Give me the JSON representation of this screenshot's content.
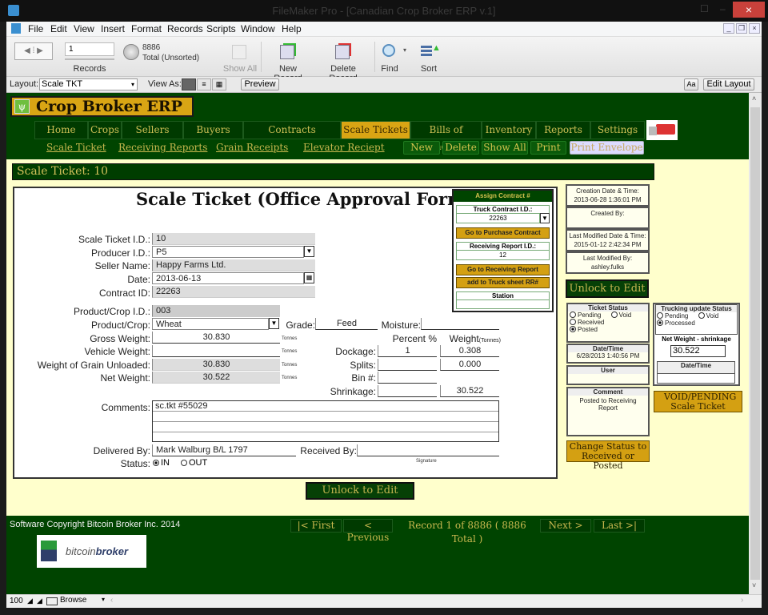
{
  "window": {
    "title": "FileMaker Pro - [Canadian Crop Broker ERP v.1]",
    "close": "×"
  },
  "menu": [
    "File",
    "Edit",
    "View",
    "Insert",
    "Format",
    "Records",
    "Scripts",
    "Window",
    "Help"
  ],
  "toolbar": {
    "record_number": "1",
    "records_label": "Records",
    "found_count": "8886",
    "found_status": "Total (Unsorted)",
    "show_all": "Show All",
    "new_record": "New Record",
    "delete_record": "Delete Record",
    "find": "Find",
    "sort": "Sort"
  },
  "layoutbar": {
    "layout_label": "Layout:",
    "layout_value": "Scale TKT",
    "view_as_label": "View As:",
    "preview": "Preview",
    "aa": "Aa",
    "edit_layout": "Edit Layout"
  },
  "app": {
    "brand": "Crop Broker ERP",
    "colors": {
      "dark_green": "#004400",
      "gold": "#d9a514",
      "cream": "#ffffcc"
    },
    "tabs": [
      {
        "label": "Home",
        "active": false
      },
      {
        "label": "Crops",
        "active": false
      },
      {
        "label": "Sellers",
        "active": false
      },
      {
        "label": "Buyers",
        "active": false
      },
      {
        "label": "Contracts",
        "active": false
      },
      {
        "label": "Scale Tickets",
        "active": true
      },
      {
        "label": "Bills of Lading",
        "active": false
      },
      {
        "label": "Inventory",
        "active": false
      },
      {
        "label": "Reports",
        "active": false
      },
      {
        "label": "Settings",
        "active": false
      }
    ],
    "sublinks": [
      "Scale Ticket",
      "Receiving Reports",
      "Grain Receipts",
      "Elevator Reciept"
    ],
    "actions": [
      "New",
      "Delete",
      "Show All",
      "Print",
      "Print Envelope"
    ],
    "section_title": "Scale Ticket: 10"
  },
  "form": {
    "title": "Scale Ticket (Office Approval Form)",
    "scale_ticket_id": {
      "label": "Scale Ticket I.D.:",
      "value": "10"
    },
    "producer_id": {
      "label": "Producer I.D.:",
      "value": "P5"
    },
    "seller_name": {
      "label": "Seller Name:",
      "value": "Happy Farms Ltd."
    },
    "date": {
      "label": "Date:",
      "value": "2013-06-13"
    },
    "contract_id": {
      "label": "Contract ID:",
      "value": "22263"
    },
    "product_crop_id": {
      "label": "Product/Crop I.D.:",
      "value": "003"
    },
    "product_crop": {
      "label": "Product/Crop:",
      "value": "Wheat"
    },
    "grade": {
      "label": "Grade:",
      "value": "Feed"
    },
    "moisture": {
      "label": "Moisture:",
      "value": ""
    },
    "gross_weight": {
      "label": "Gross Weight:",
      "value": "30.830"
    },
    "vehicle_weight": {
      "label": "Vehicle Weight:",
      "value": ""
    },
    "grain_unloaded": {
      "label": "Weight of Grain Unloaded:",
      "value": "30.830"
    },
    "net_weight": {
      "label": "Net Weight:",
      "value": "30.522"
    },
    "unit": "Tonnes",
    "percent_header": "Percent %",
    "weight_header": "Weight",
    "weight_unit": "(Tonnes)",
    "dockage": {
      "label": "Dockage:",
      "percent": "1",
      "weight": "0.308"
    },
    "splits": {
      "label": "Splits:",
      "percent": "",
      "weight": "0.000"
    },
    "bin": {
      "label": "Bin #:",
      "value": ""
    },
    "shrinkage": {
      "label": "Shrinkage:",
      "percent": "",
      "weight": "30.522"
    },
    "comments": {
      "label": "Comments:",
      "value": "sc.tkt #55029"
    },
    "delivered_by": {
      "label": "Delivered By:",
      "value": "Mark Walburg B/L 1797"
    },
    "received_by": {
      "label": "Received By:",
      "value": ""
    },
    "signature": "Signature",
    "status": {
      "label": "Status:",
      "in": "IN",
      "out": "OUT",
      "selected": "IN"
    }
  },
  "assign": {
    "header": "Assign Contract #",
    "truck_contract_label": "Truck Contract I.D.:",
    "truck_contract_value": "22263",
    "go_purchase": "Go to Purchase Contract",
    "rr_label": "Receiving Report I.D.:",
    "rr_value": "12",
    "go_rr": "Go to Receiving Report",
    "add_truck": "add to Truck sheet RR#",
    "station_label": "Station",
    "station_value": ""
  },
  "meta": {
    "creation_label": "Creation Date & Time:",
    "creation_value": "2013-06-28 1:36:01 PM",
    "created_by_label": "Created By:",
    "created_by_value": "",
    "modified_label": "Last Modified Date & Time:",
    "modified_value": "2015-01-12 2:42:34 PM",
    "modified_by_label": "Last Modified By:",
    "modified_by_value": "ashley.fulks"
  },
  "unlock": "Unlock to Edit",
  "ticket_status": {
    "header": "Ticket Status",
    "options": [
      "Pending",
      "Void",
      "Received",
      "Posted"
    ],
    "selected": "Posted",
    "datetime_label": "Date/Time",
    "datetime_value": "6/28/2013 1:40:56 PM",
    "user_label": "User",
    "user_value": "",
    "comment_label": "Comment",
    "comment_value": "Posted to Receiving Report",
    "change_btn": "Change Status to Received or Posted"
  },
  "trucking": {
    "header": "Trucking update Status",
    "options": [
      "Pending",
      "Void",
      "Processed"
    ],
    "selected": "Processed",
    "net_label": "Net Weight - shrinkage",
    "net_value": "30.522",
    "datetime_label": "Date/Time",
    "datetime_value": "",
    "void_btn": "VOID/PENDING Scale Ticket"
  },
  "footer": {
    "copyright": "Software Copyright Bitcoin Broker Inc. 2014",
    "logo_a": "bitcoin",
    "logo_b": "broker",
    "first": "|< First",
    "previous": "< Previous",
    "record_info": "Record 1 of 8886 ( 8886 Total )",
    "next": "Next >",
    "last": "Last >|"
  },
  "statusbar": {
    "zoom": "100",
    "mode": "Browse"
  }
}
